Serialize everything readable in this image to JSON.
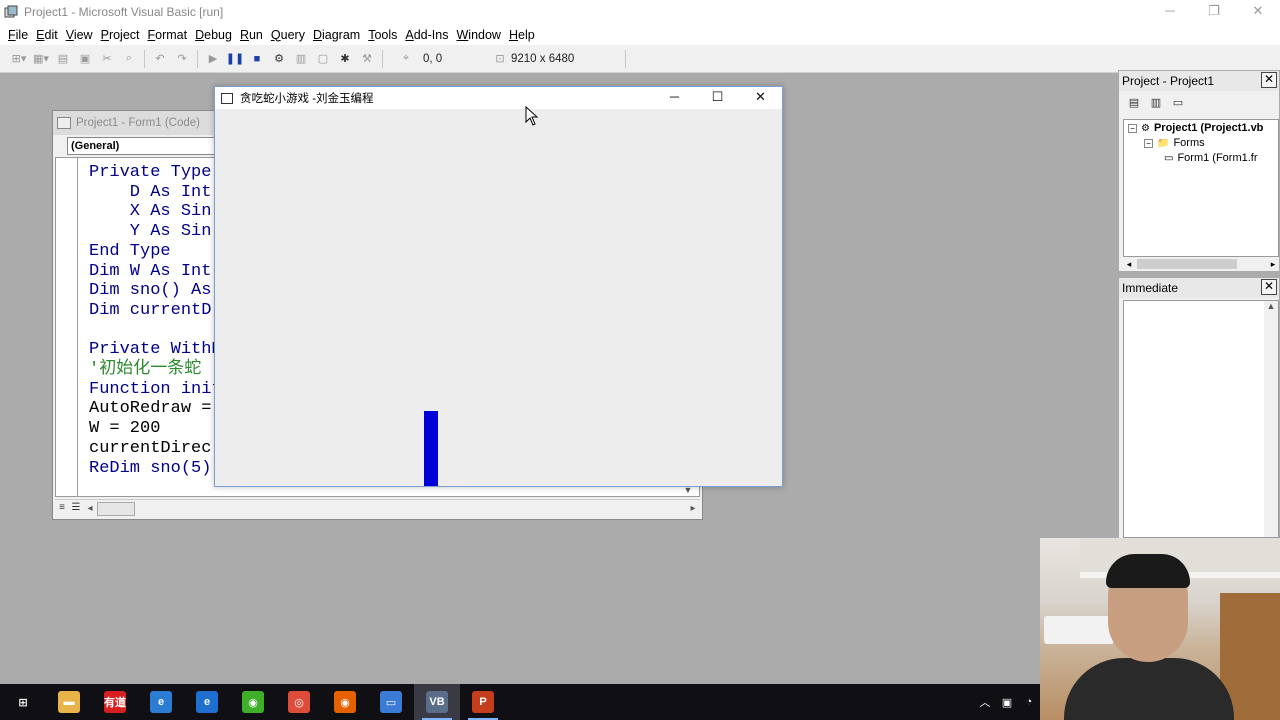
{
  "window": {
    "title": "Project1 - Microsoft Visual Basic [run]",
    "controls": {
      "minimize": "─",
      "restore": "❐",
      "close": "✕"
    }
  },
  "menu": [
    {
      "label": "File",
      "u": "F",
      "rest": "ile"
    },
    {
      "label": "Edit",
      "u": "E",
      "rest": "dit"
    },
    {
      "label": "View",
      "u": "V",
      "rest": "iew"
    },
    {
      "label": "Project",
      "u": "P",
      "rest": "roject"
    },
    {
      "label": "Format",
      "u": "F",
      "rest": "ormat"
    },
    {
      "label": "Debug",
      "u": "D",
      "rest": "ebug"
    },
    {
      "label": "Run",
      "u": "R",
      "rest": "un"
    },
    {
      "label": "Query",
      "u": "Q",
      "rest": "uery"
    },
    {
      "label": "Diagram",
      "u": "D",
      "rest": "iagram"
    },
    {
      "label": "Tools",
      "u": "T",
      "rest": "ools"
    },
    {
      "label": "Add-Ins",
      "u": "A",
      "rest": "dd-Ins"
    },
    {
      "label": "Window",
      "u": "W",
      "rest": "indow"
    },
    {
      "label": "Help",
      "u": "H",
      "rest": "elp"
    }
  ],
  "toolbar": {
    "position_readout": "0, 0",
    "size_readout": "9210 x 6480"
  },
  "code_window": {
    "title": "Project1 - Form1 (Code)",
    "object_combo": "(General)",
    "lines": [
      {
        "text": "Private Type",
        "style": "kw"
      },
      {
        "text": "    D As Int",
        "style": "kw"
      },
      {
        "text": "    X As Sin",
        "style": "kw"
      },
      {
        "text": "    Y As Sin",
        "style": "kw"
      },
      {
        "text": "End Type",
        "style": "kw"
      },
      {
        "text": "Dim W As Int",
        "style": "kw"
      },
      {
        "text": "Dim sno() As",
        "style": "kw"
      },
      {
        "text": "Dim currentD",
        "style": "kw"
      },
      {
        "text": "",
        "style": "plain"
      },
      {
        "text": "Private WithE",
        "style": "kw"
      },
      {
        "text": "'初始化一条蛇",
        "style": "cm"
      },
      {
        "text": "Function init",
        "style": "kw"
      },
      {
        "text": "AutoRedraw =",
        "style": "plain"
      },
      {
        "text": "W = 200",
        "style": "plain"
      },
      {
        "text": "currentDirec",
        "style": "plain"
      },
      {
        "text": "ReDim sno(5)",
        "style": "kw"
      }
    ]
  },
  "game_window": {
    "title": "贪吃蛇小游戏 -刘金玉编程",
    "controls": {
      "minimize": "─",
      "maximize": "☐",
      "close": "✕"
    }
  },
  "project_panel": {
    "title": "Project - Project1",
    "close": "✕",
    "tree": [
      {
        "label": "Project1 (Project1.vb",
        "bold": true,
        "expander": "⊟"
      },
      {
        "label": "Forms",
        "bold": false,
        "expander": "⊟"
      },
      {
        "label": "Form1 (Form1.fr",
        "bold": false,
        "expander": ""
      }
    ]
  },
  "immediate_panel": {
    "title": "Immediate",
    "close": "✕"
  },
  "taskbar": {
    "items": [
      {
        "name": "start",
        "glyph": "⊞",
        "color": "#0f0f14",
        "active": false,
        "running": false
      },
      {
        "name": "file-explorer",
        "glyph": "▬",
        "color": "#e8b44a",
        "active": false,
        "running": false
      },
      {
        "name": "youdao-dict",
        "glyph": "有道",
        "color": "#d81e1e",
        "active": false,
        "running": false
      },
      {
        "name": "internet-explorer",
        "glyph": "e",
        "color": "#2b7cd3",
        "active": false,
        "running": false
      },
      {
        "name": "edge",
        "glyph": "e",
        "color": "#1f6fd1",
        "active": false,
        "running": false
      },
      {
        "name": "browser-360",
        "glyph": "◉",
        "color": "#3fae29",
        "active": false,
        "running": false
      },
      {
        "name": "chrome",
        "glyph": "◎",
        "color": "#dd4b39",
        "active": false,
        "running": false
      },
      {
        "name": "firefox",
        "glyph": "◉",
        "color": "#e66000",
        "active": false,
        "running": false
      },
      {
        "name": "remote-desktop",
        "glyph": "▭",
        "color": "#3a7bd5",
        "active": false,
        "running": false
      },
      {
        "name": "visual-basic",
        "glyph": "VB",
        "color": "#5a6e8a",
        "active": true,
        "running": true
      },
      {
        "name": "powerpoint",
        "glyph": "P",
        "color": "#c43e1c",
        "active": false,
        "running": true
      }
    ]
  }
}
